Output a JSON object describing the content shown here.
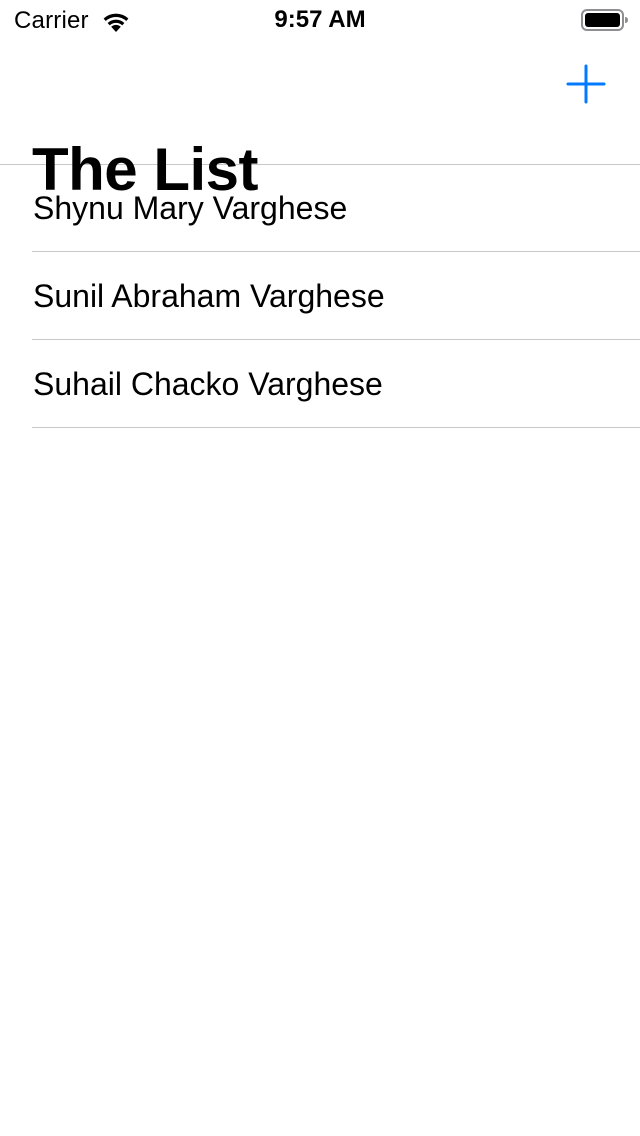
{
  "status_bar": {
    "carrier": "Carrier",
    "time": "9:57 AM",
    "wifi_icon": "wifi-icon",
    "battery_icon": "battery-icon",
    "battery_level": 1.0
  },
  "nav": {
    "title": "The List",
    "add_icon": "plus-icon",
    "accent_color": "#007aff"
  },
  "list": {
    "items": [
      {
        "label": "Shynu Mary Varghese"
      },
      {
        "label": "Sunil Abraham Varghese"
      },
      {
        "label": "Suhail Chacko Varghese"
      }
    ],
    "separator_color": "#c8c7cc"
  }
}
